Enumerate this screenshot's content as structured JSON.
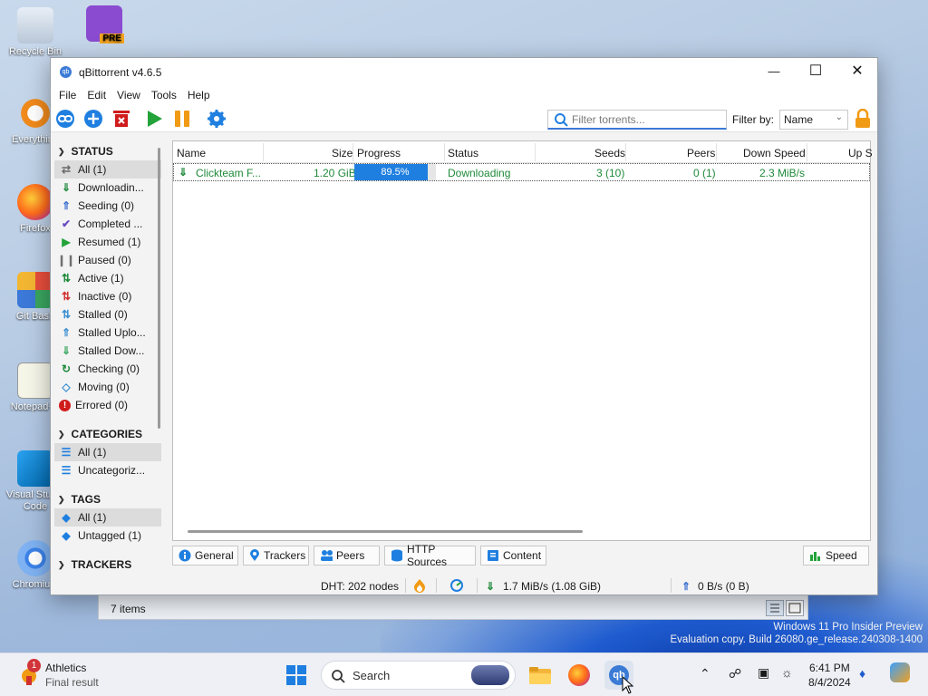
{
  "desktop": {
    "icons": [
      {
        "label": "Recycle Bin",
        "icon": "recycle-bin-icon"
      },
      {
        "label": "Visual Studio",
        "icon": "visual-studio-pre-icon"
      },
      {
        "label": "Everything",
        "icon": "everything-search-icon"
      },
      {
        "label": "Firefox",
        "icon": "firefox-icon"
      },
      {
        "label": "Git Bash",
        "icon": "git-bash-icon"
      },
      {
        "label": "Notepad++",
        "icon": "notepad-plus-plus-icon"
      },
      {
        "label": "Visual Studio Code",
        "icon": "vscode-icon"
      },
      {
        "label": "Chromium",
        "icon": "chromium-icon"
      }
    ],
    "watermark_line1": "Windows 11 Pro Insider Preview",
    "watermark_line2": "Evaluation copy. Build 26080.ge_release.240308-1400"
  },
  "back_window": {
    "items_count": "7 items"
  },
  "window": {
    "title": "qBittorrent v4.6.5",
    "controls": {
      "minimize": "—",
      "maximize": "☐",
      "close": "✕"
    }
  },
  "menu": [
    "File",
    "Edit",
    "View",
    "Tools",
    "Help"
  ],
  "toolbar": {
    "buttons": [
      "add-link-icon",
      "add-torrent-icon",
      "delete-icon",
      "resume-icon",
      "pause-icon",
      "options-gear-icon"
    ],
    "search_placeholder": "Filter torrents...",
    "filter_label": "Filter by:",
    "filter_value": "Name"
  },
  "sidebar": {
    "status_header": "STATUS",
    "status_items": [
      {
        "label": "All (1)",
        "icon": "all-shuffle-icon",
        "color": "#6a6a6a"
      },
      {
        "label": "Downloadin...",
        "icon": "downloading-icon",
        "color": "#1f8a3a"
      },
      {
        "label": "Seeding (0)",
        "icon": "seeding-icon",
        "color": "#3a6fd0"
      },
      {
        "label": "Completed ...",
        "icon": "completed-check-icon",
        "color": "#6b4bc4"
      },
      {
        "label": "Resumed (1)",
        "icon": "resumed-play-icon",
        "color": "#23a33a"
      },
      {
        "label": "Paused (0)",
        "icon": "paused-icon",
        "color": "#707070"
      },
      {
        "label": "Active (1)",
        "icon": "active-arrows-icon",
        "color": "#1f8a3a"
      },
      {
        "label": "Inactive (0)",
        "icon": "inactive-arrows-icon",
        "color": "#d03030"
      },
      {
        "label": "Stalled (0)",
        "icon": "stalled-arrows-icon",
        "color": "#3a8fd0"
      },
      {
        "label": "Stalled Uplo...",
        "icon": "stalled-upload-icon",
        "color": "#3a8fd0"
      },
      {
        "label": "Stalled Dow...",
        "icon": "stalled-download-icon",
        "color": "#3aa860"
      },
      {
        "label": "Checking (0)",
        "icon": "checking-icon",
        "color": "#1f8a3a"
      },
      {
        "label": "Moving (0)",
        "icon": "moving-icon",
        "color": "#3a8fd0"
      },
      {
        "label": "Errored (0)",
        "icon": "error-icon",
        "color": "#d01c1c"
      }
    ],
    "categories_header": "CATEGORIES",
    "category_items": [
      {
        "label": "All (1)",
        "icon": "list-icon"
      },
      {
        "label": "Uncategoriz...",
        "icon": "list-icon"
      }
    ],
    "tags_header": "TAGS",
    "tag_items": [
      {
        "label": "All (1)",
        "icon": "tag-icon"
      },
      {
        "label": "Untagged (1)",
        "icon": "tag-icon"
      }
    ],
    "trackers_header": "TRACKERS"
  },
  "table": {
    "columns": [
      "Name",
      "Size",
      "Progress",
      "Status",
      "Seeds",
      "Peers",
      "Down Speed",
      "Up S"
    ],
    "rows": [
      {
        "name": "Clickteam F...",
        "size": "1.20 GiB",
        "progress": 89.5,
        "progress_label": "89.5%",
        "status": "Downloading",
        "seeds": "3 (10)",
        "peers": "0 (1)",
        "down_speed": "2.3 MiB/s"
      }
    ]
  },
  "bottom_tabs": [
    "General",
    "Trackers",
    "Peers",
    "HTTP Sources",
    "Content"
  ],
  "speed_tab": "Speed",
  "statusbar": {
    "dht": "DHT: 202 nodes",
    "down": "1.7 MiB/s (1.08 GiB)",
    "up": "0 B/s (0 B)"
  },
  "taskbar": {
    "widget_badge": "1",
    "widget_title": "Athletics",
    "widget_sub": "Final result",
    "search_placeholder": "Search",
    "time": "6:41 PM",
    "date": "8/4/2024"
  }
}
